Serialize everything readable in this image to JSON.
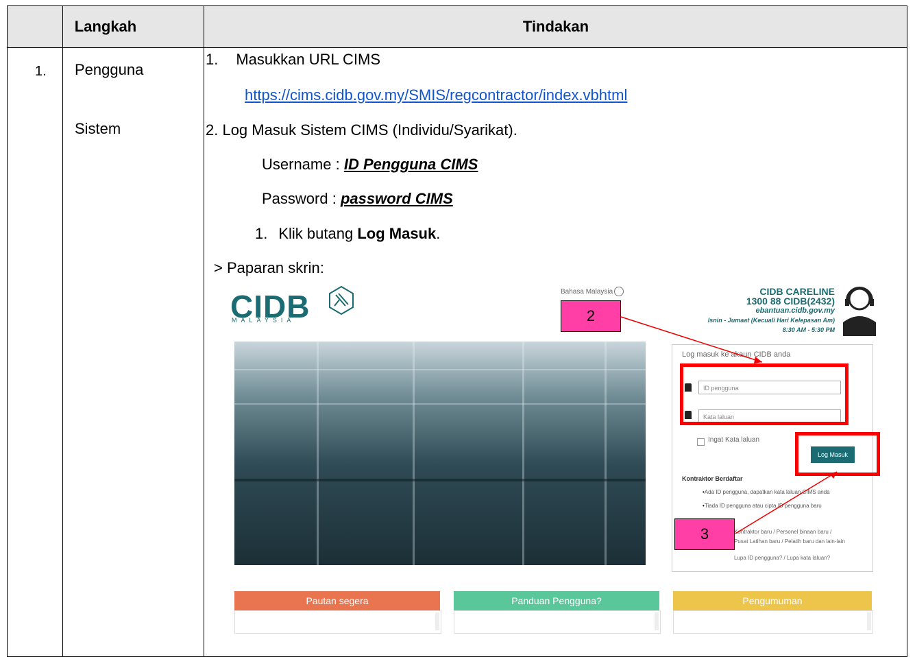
{
  "table": {
    "header": {
      "col1": "Langkah",
      "col2": "Tindakan"
    },
    "row": {
      "number": "1.",
      "actor_line1": "Pengguna",
      "actor_line2": "Sistem"
    }
  },
  "steps": {
    "s1_num": "1.",
    "s1_text": "Masukkan URL CIMS",
    "url": "https://cims.cidb.gov.my/SMIS/regcontractor/index.vbhtml",
    "s2_text": "2.  Log Masuk Sistem CIMS (Individu/Syarikat).",
    "username_label": "Username : ",
    "username_value": "ID Pengguna CIMS",
    "password_label": "Password : ",
    "password_value": "password CIMS",
    "sub_num": "1.",
    "sub_text_pre": "Klik butang ",
    "sub_text_bold": "Log Masuk",
    "sub_text_post": ".",
    "screen_label": "> Paparan skrin:"
  },
  "screenshot": {
    "logo": "CIDB",
    "logo_sub": "MALAYSIA",
    "language": "Bahasa Malaysia",
    "careline": {
      "title": "CIDB CARELINE",
      "phone": "1300 88 CIDB(2432)",
      "web": "ebantuan.cidb.gov.my",
      "days": "Isnin - Jumaat (Kecuali Hari Kelepasan Am)",
      "hours": "8:30 AM - 5:30 PM"
    },
    "login": {
      "title": "Log masuk ke akaun CIDB anda",
      "user_placeholder": "ID pengguna",
      "pass_placeholder": "Kata laluan",
      "remember": "Ingat Kata laluan",
      "button": "Log Masuk",
      "section": "Kontraktor Berdaftar",
      "bullet1": "Ada ID pengguna, dapatkan kata laluan CIMS anda",
      "bullet2": "Tiada ID pengguna atau cipta ID pengguna baru",
      "misc1": "Kontraktor baru / Personel binaan baru /",
      "misc2": "Pusat Latihan baru / Pelatih baru dan lain-lain",
      "misc3": "Lupa ID pengguna? / Lupa kata laluan?"
    },
    "tabs": [
      {
        "label": "Pautan segera",
        "color": "#e8754f"
      },
      {
        "label": "Panduan Pengguna?",
        "color": "#5ac79b"
      },
      {
        "label": "Pengumuman",
        "color": "#ecc54a"
      }
    ],
    "markers": {
      "m2": "2",
      "m3": "3"
    }
  }
}
